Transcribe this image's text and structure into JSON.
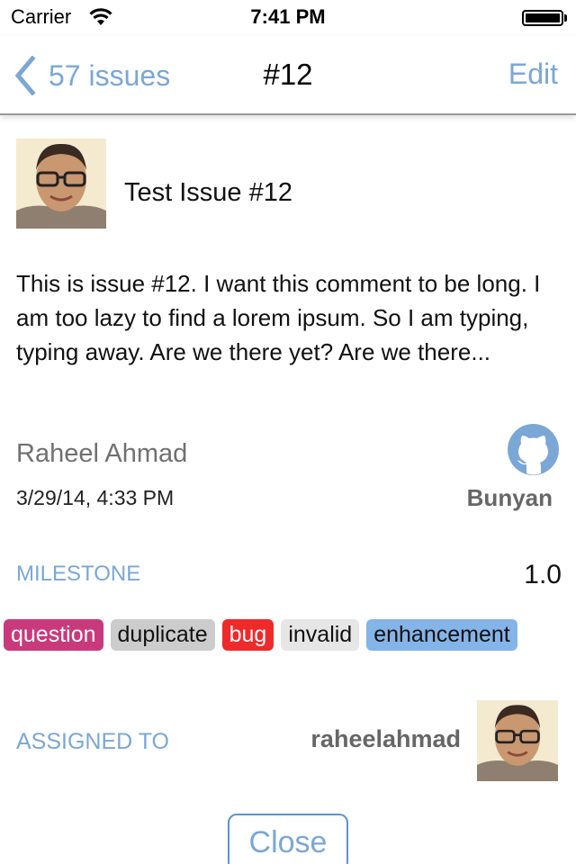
{
  "status_bar": {
    "carrier": "Carrier",
    "time": "7:41 PM",
    "wifi_icon": "wifi-icon",
    "battery_icon": "battery-full-icon",
    "battery_level": 1.0
  },
  "nav": {
    "back_label": "57 issues",
    "back_icon": "chevron-left-icon",
    "title": "#12",
    "edit_label": "Edit"
  },
  "issue": {
    "title": "Test Issue #12",
    "body": "This is issue #12. I want this comment to be long. I am too lazy to find a lorem ipsum. So I am typing, typing away. Are we there yet? Are we there...",
    "author": "Raheel Ahmad",
    "created_at": "3/29/14, 4:33 PM",
    "repo_icon": "github-octocat-icon",
    "repo": "Bunyan",
    "milestone_label": "MILESTONE",
    "milestone": "1.0",
    "labels": [
      {
        "name": "question",
        "bg": "#c83a7c",
        "fg": "#ffffff"
      },
      {
        "name": "duplicate",
        "bg": "#cccccc",
        "fg": "#111111"
      },
      {
        "name": "bug",
        "bg": "#ee2a2a",
        "fg": "#ffffff"
      },
      {
        "name": "invalid",
        "bg": "#e6e6e6",
        "fg": "#111111"
      },
      {
        "name": "enhancement",
        "bg": "#84b4e8",
        "fg": "#111111"
      }
    ],
    "assigned_label": "ASSIGNED TO",
    "assignee": "raheelahmad"
  },
  "actions": {
    "close_label": "Close"
  },
  "colors": {
    "accent": "#7aa7d6",
    "secondary_text": "#707070"
  }
}
